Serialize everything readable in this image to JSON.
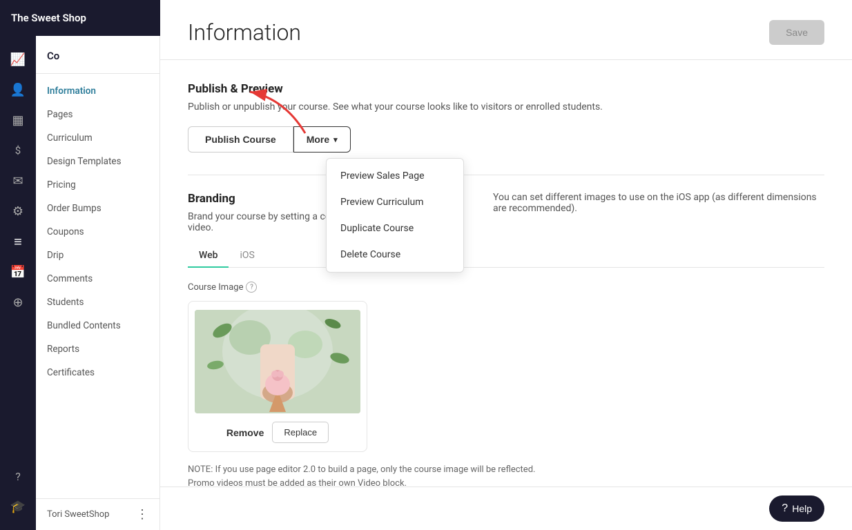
{
  "app": {
    "title": "The Sweet Shop"
  },
  "nav_rail": {
    "icons": [
      {
        "name": "analytics-icon",
        "symbol": "📈"
      },
      {
        "name": "users-icon",
        "symbol": "👤"
      },
      {
        "name": "layout-icon",
        "symbol": "▦"
      },
      {
        "name": "dollar-icon",
        "symbol": "$"
      },
      {
        "name": "mail-icon",
        "symbol": "✉"
      },
      {
        "name": "settings-icon",
        "symbol": "⚙"
      },
      {
        "name": "courses-icon",
        "symbol": "≡"
      },
      {
        "name": "calendar-icon",
        "symbol": "📅"
      },
      {
        "name": "integrations-icon",
        "symbol": "⊕"
      },
      {
        "name": "help-circle-icon",
        "symbol": "?"
      },
      {
        "name": "graduation-icon",
        "symbol": "🎓"
      }
    ]
  },
  "sidebar": {
    "header": "Co",
    "items": [
      {
        "label": "Information",
        "active": true
      },
      {
        "label": "Pages",
        "active": false
      },
      {
        "label": "Curriculum",
        "active": false
      },
      {
        "label": "Design Templates",
        "active": false
      },
      {
        "label": "Pricing",
        "active": false
      },
      {
        "label": "Order Bumps",
        "active": false
      },
      {
        "label": "Coupons",
        "active": false
      },
      {
        "label": "Drip",
        "active": false
      },
      {
        "label": "Comments",
        "active": false
      },
      {
        "label": "Students",
        "active": false
      },
      {
        "label": "Bundled Contents",
        "active": false
      },
      {
        "label": "Reports",
        "active": false
      },
      {
        "label": "Certificates",
        "active": false
      }
    ],
    "footer_user": "Tori SweetShop"
  },
  "main": {
    "title": "Information",
    "save_button": "Save",
    "sections": {
      "publish_preview": {
        "title": "Publish & Preview",
        "description": "Publish or unpublish your course. See what your course looks like to visitors or enrolled students."
      },
      "branding": {
        "title": "Branding",
        "description": "Brand your course by sett",
        "extra_description": "You can set different images to use on the iOS app (as different dimensions are recommended)."
      }
    },
    "buttons": {
      "publish_course": "Publish Course",
      "more": "More"
    },
    "dropdown": {
      "items": [
        "Preview Sales Page",
        "Preview Curriculum",
        "Duplicate Course",
        "Delete Course"
      ]
    },
    "tabs": {
      "items": [
        {
          "label": "Web",
          "active": true
        },
        {
          "label": "iOS",
          "active": false
        }
      ]
    },
    "course_image": {
      "label": "Course Image",
      "remove_btn": "Remove",
      "replace_btn": "Replace"
    },
    "note": {
      "line1": "NOTE: If you use page editor 2.0 to build a page, only the course image will be reflected.",
      "line2": "Promo videos must be added as their own Video block."
    },
    "help_button": "Help"
  }
}
